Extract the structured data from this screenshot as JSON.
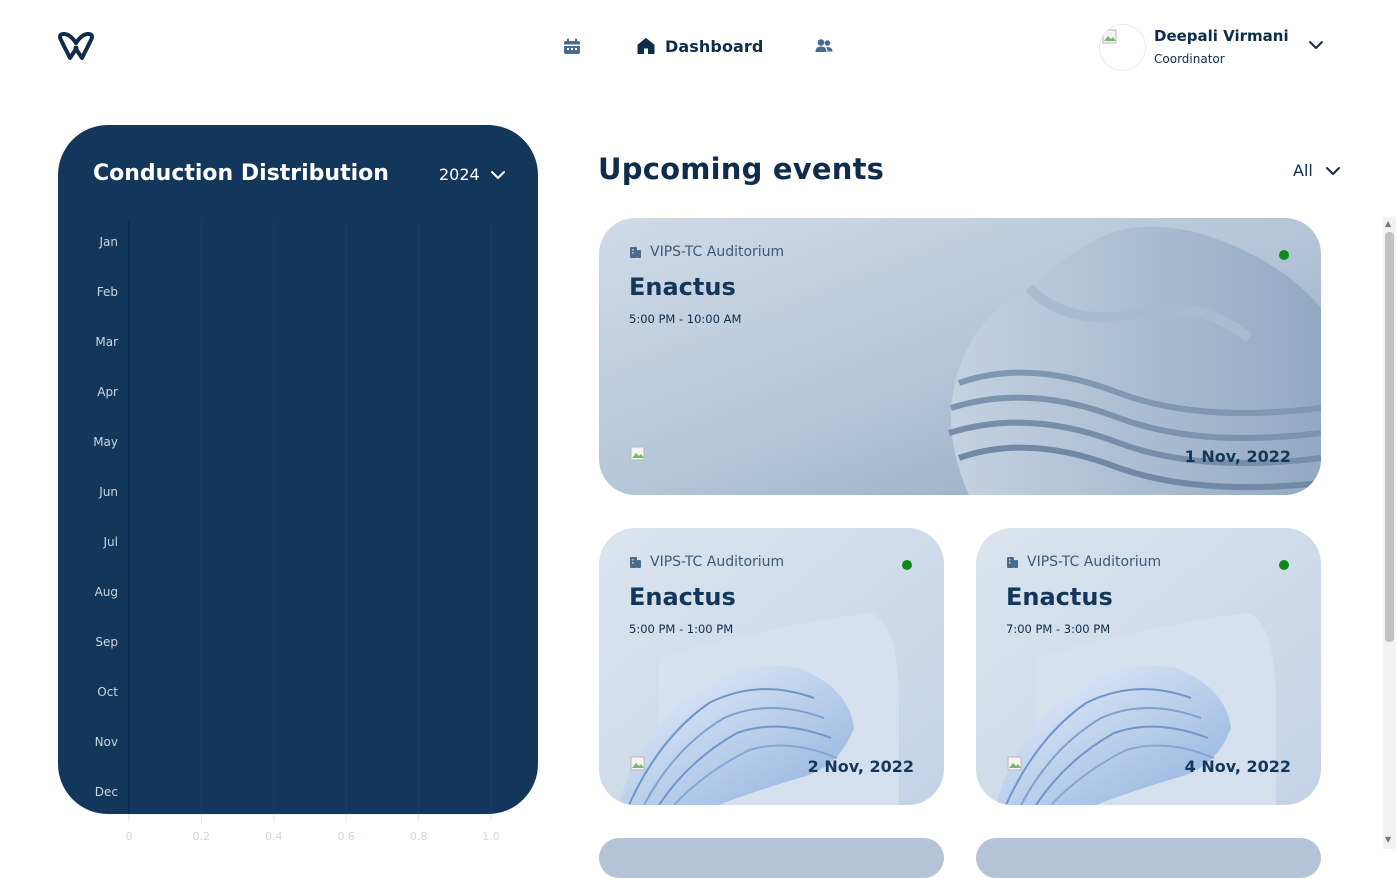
{
  "header": {
    "logo_icon": "w-logo-icon",
    "nav": {
      "calendar_icon": "calendar-icon",
      "dashboard_label": "Dashboard",
      "home_icon": "home-icon",
      "people_icon": "people-icon"
    },
    "user": {
      "name": "Deepali Virmani",
      "role": "Coordinator",
      "menu_icon": "chevron-down-icon"
    }
  },
  "distribution": {
    "title": "Conduction Distribution",
    "year": "2024"
  },
  "chart_data": {
    "type": "bar",
    "orientation": "horizontal",
    "categories": [
      "Jan",
      "Feb",
      "Mar",
      "Apr",
      "May",
      "Jun",
      "Jul",
      "Aug",
      "Sep",
      "Oct",
      "Nov",
      "Dec"
    ],
    "values": [
      0,
      0,
      0,
      0,
      0,
      0,
      0,
      0,
      0,
      0,
      0,
      0
    ],
    "x_ticks": [
      "0",
      "0.2",
      "0.4",
      "0.6",
      "0.8",
      "1.0"
    ],
    "xlim": [
      0,
      1
    ],
    "grid": true,
    "title": "",
    "xlabel": "",
    "ylabel": ""
  },
  "events": {
    "title": "Upcoming events",
    "filter": "All",
    "cards": [
      {
        "venue": "VIPS-TC Auditorium",
        "name": "Enactus",
        "time": "5:00 PM - 10:00 AM",
        "date": "1 Nov, 2022",
        "status_color": "#0d8a1a"
      },
      {
        "venue": "VIPS-TC Auditorium",
        "name": "Enactus",
        "time": "5:00 PM - 1:00 PM",
        "date": "2 Nov, 2022",
        "status_color": "#0d8a1a"
      },
      {
        "venue": "VIPS-TC Auditorium",
        "name": "Enactus",
        "time": "7:00 PM - 3:00 PM",
        "date": "4 Nov, 2022",
        "status_color": "#0d8a1a"
      }
    ]
  },
  "colors": {
    "primary": "#13375b",
    "status_live": "#0d8a1a"
  }
}
